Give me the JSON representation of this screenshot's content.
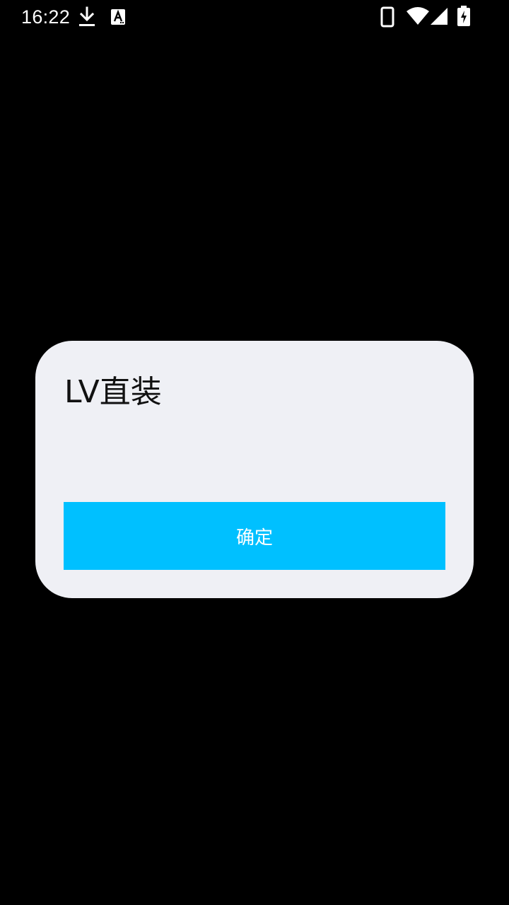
{
  "status_bar": {
    "time": "16:22",
    "icons": [
      "download-icon",
      "text-a-icon",
      "phone-icon",
      "wifi-icon",
      "signal-icon",
      "battery-charging-icon"
    ]
  },
  "dialog": {
    "title": "LV直装",
    "confirm_label": "确定"
  },
  "colors": {
    "background": "#000000",
    "dialog_background": "#eff0f5",
    "button": "#00c0ff",
    "button_text": "#ffffff",
    "title_text": "#111111"
  }
}
